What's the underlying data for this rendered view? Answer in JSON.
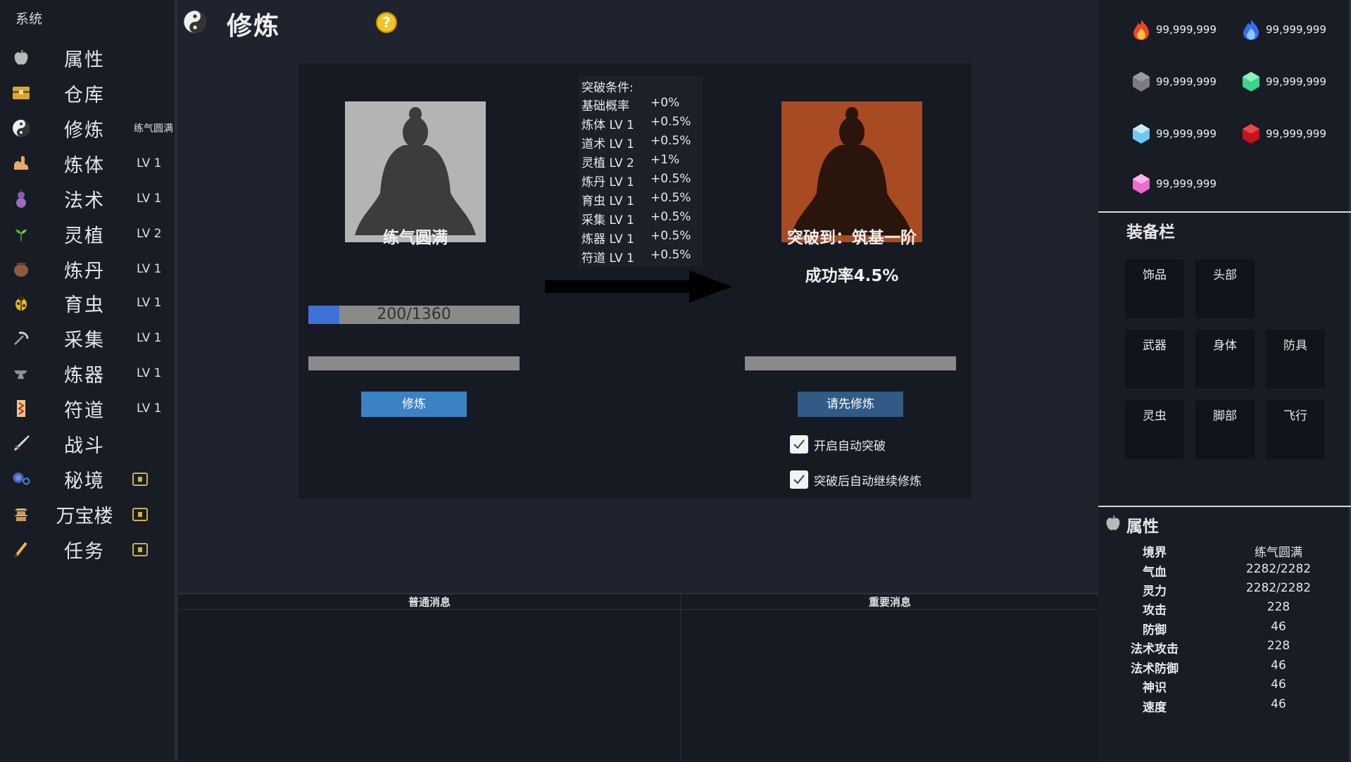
{
  "sidebar": {
    "system_label": "系统",
    "items": [
      {
        "label": "属性",
        "badge": "",
        "icon": "apple-icon"
      },
      {
        "label": "仓库",
        "badge": "",
        "icon": "chest-icon"
      },
      {
        "label": "修炼",
        "badge": "练气圆满",
        "icon": "yin-yang-icon"
      },
      {
        "label": "炼体",
        "badge": "LV 1",
        "icon": "flexed-arm-icon"
      },
      {
        "label": "法术",
        "badge": "LV 1",
        "icon": "gourd-icon"
      },
      {
        "label": "灵植",
        "badge": "LV 2",
        "icon": "sprout-icon"
      },
      {
        "label": "炼丹",
        "badge": "LV 1",
        "icon": "cauldron-icon"
      },
      {
        "label": "育虫",
        "badge": "LV 1",
        "icon": "beetle-icon"
      },
      {
        "label": "采集",
        "badge": "LV 1",
        "icon": "pickaxe-icon"
      },
      {
        "label": "炼器",
        "badge": "LV 1",
        "icon": "anvil-icon"
      },
      {
        "label": "符道",
        "badge": "LV 1",
        "icon": "talisman-icon"
      },
      {
        "label": "战斗",
        "badge": "",
        "icon": "sword-icon"
      },
      {
        "label": "秘境",
        "badge": "",
        "icon": "portal-icon",
        "locked": true
      },
      {
        "label": "万宝楼",
        "badge": "",
        "icon": "pagoda-icon",
        "locked": true
      },
      {
        "label": "任务",
        "badge": "",
        "icon": "brush-icon",
        "locked": true
      }
    ]
  },
  "header": {
    "title": "修炼",
    "help_symbol": "?"
  },
  "cultivation": {
    "current_stage": "练气圆满",
    "progress_text": "200/1360",
    "progress_value": 200,
    "progress_max": 1360,
    "cultivate_button": "修炼",
    "conditions_title": "突破条件:",
    "conditions": [
      {
        "name": "基础概率",
        "value": "+0%"
      },
      {
        "name": "炼体 LV 1",
        "value": "+0.5%"
      },
      {
        "name": "道术 LV 1",
        "value": "+0.5%"
      },
      {
        "name": "灵植 LV 2",
        "value": "+1%"
      },
      {
        "name": "炼丹 LV 1",
        "value": "+0.5%"
      },
      {
        "name": "育虫 LV 1",
        "value": "+0.5%"
      },
      {
        "name": "采集 LV 1",
        "value": "+0.5%"
      },
      {
        "name": "炼器 LV 1",
        "value": "+0.5%"
      },
      {
        "name": "符道 LV 1",
        "value": "+0.5%"
      }
    ],
    "breakthrough_target": "突破到：筑基一阶",
    "success_rate": "成功率4.5%",
    "breakthrough_button": "请先修炼",
    "auto_breakthrough_label": "开启自动突破",
    "auto_breakthrough_checked": true,
    "continue_after_label": "突破后自动继续修炼",
    "continue_after_checked": true,
    "accent_color": "#3f72d8",
    "target_portrait_color": "#a84a22"
  },
  "messages": {
    "normal_header": "普通消息",
    "important_header": "重要消息"
  },
  "resources": [
    {
      "icon": "red-flame-icon",
      "value": "99,999,999",
      "color": "#e8452c"
    },
    {
      "icon": "blue-flame-icon",
      "value": "99,999,999",
      "color": "#3a6cf0"
    },
    {
      "icon": "gray-stone-icon",
      "value": "99,999,999",
      "color": "#7c7c80"
    },
    {
      "icon": "green-gem-icon",
      "value": "99,999,999",
      "color": "#3fd48a"
    },
    {
      "icon": "cyan-gem-icon",
      "value": "99,999,999",
      "color": "#6ec8f4"
    },
    {
      "icon": "red-gem-icon",
      "value": "99,999,999",
      "color": "#c4141c"
    },
    {
      "icon": "pink-gem-icon",
      "value": "99,999,999",
      "color": "#f06ad0"
    }
  ],
  "equipment": {
    "title": "装备栏",
    "slots": [
      "饰品",
      "头部",
      "武器",
      "身体",
      "防具",
      "灵虫",
      "脚部",
      "飞行"
    ]
  },
  "attributes": {
    "title": "属性",
    "rows": [
      {
        "name": "境界",
        "value": "练气圆满"
      },
      {
        "name": "气血",
        "value": "2282/2282"
      },
      {
        "name": "灵力",
        "value": "2282/2282"
      },
      {
        "name": "攻击",
        "value": "228"
      },
      {
        "name": "防御",
        "value": "46"
      },
      {
        "name": "法术攻击",
        "value": "228"
      },
      {
        "name": "法术防御",
        "value": "46"
      },
      {
        "name": "神识",
        "value": "46"
      },
      {
        "name": "速度",
        "value": "46"
      }
    ]
  }
}
